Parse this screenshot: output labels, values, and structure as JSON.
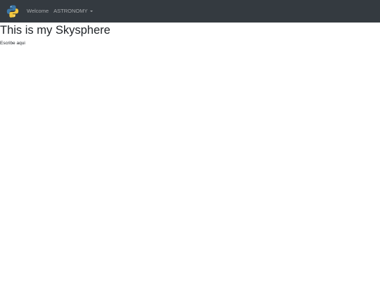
{
  "navbar": {
    "brand_icon": "python-logo-icon",
    "links": [
      {
        "label": "Welcome"
      },
      {
        "label": "ASTRONOMY",
        "dropdown": true
      }
    ],
    "background_color": "#343a40"
  },
  "main": {
    "title": "This is my Skysphere",
    "subtitle": "Escribe aqui"
  }
}
